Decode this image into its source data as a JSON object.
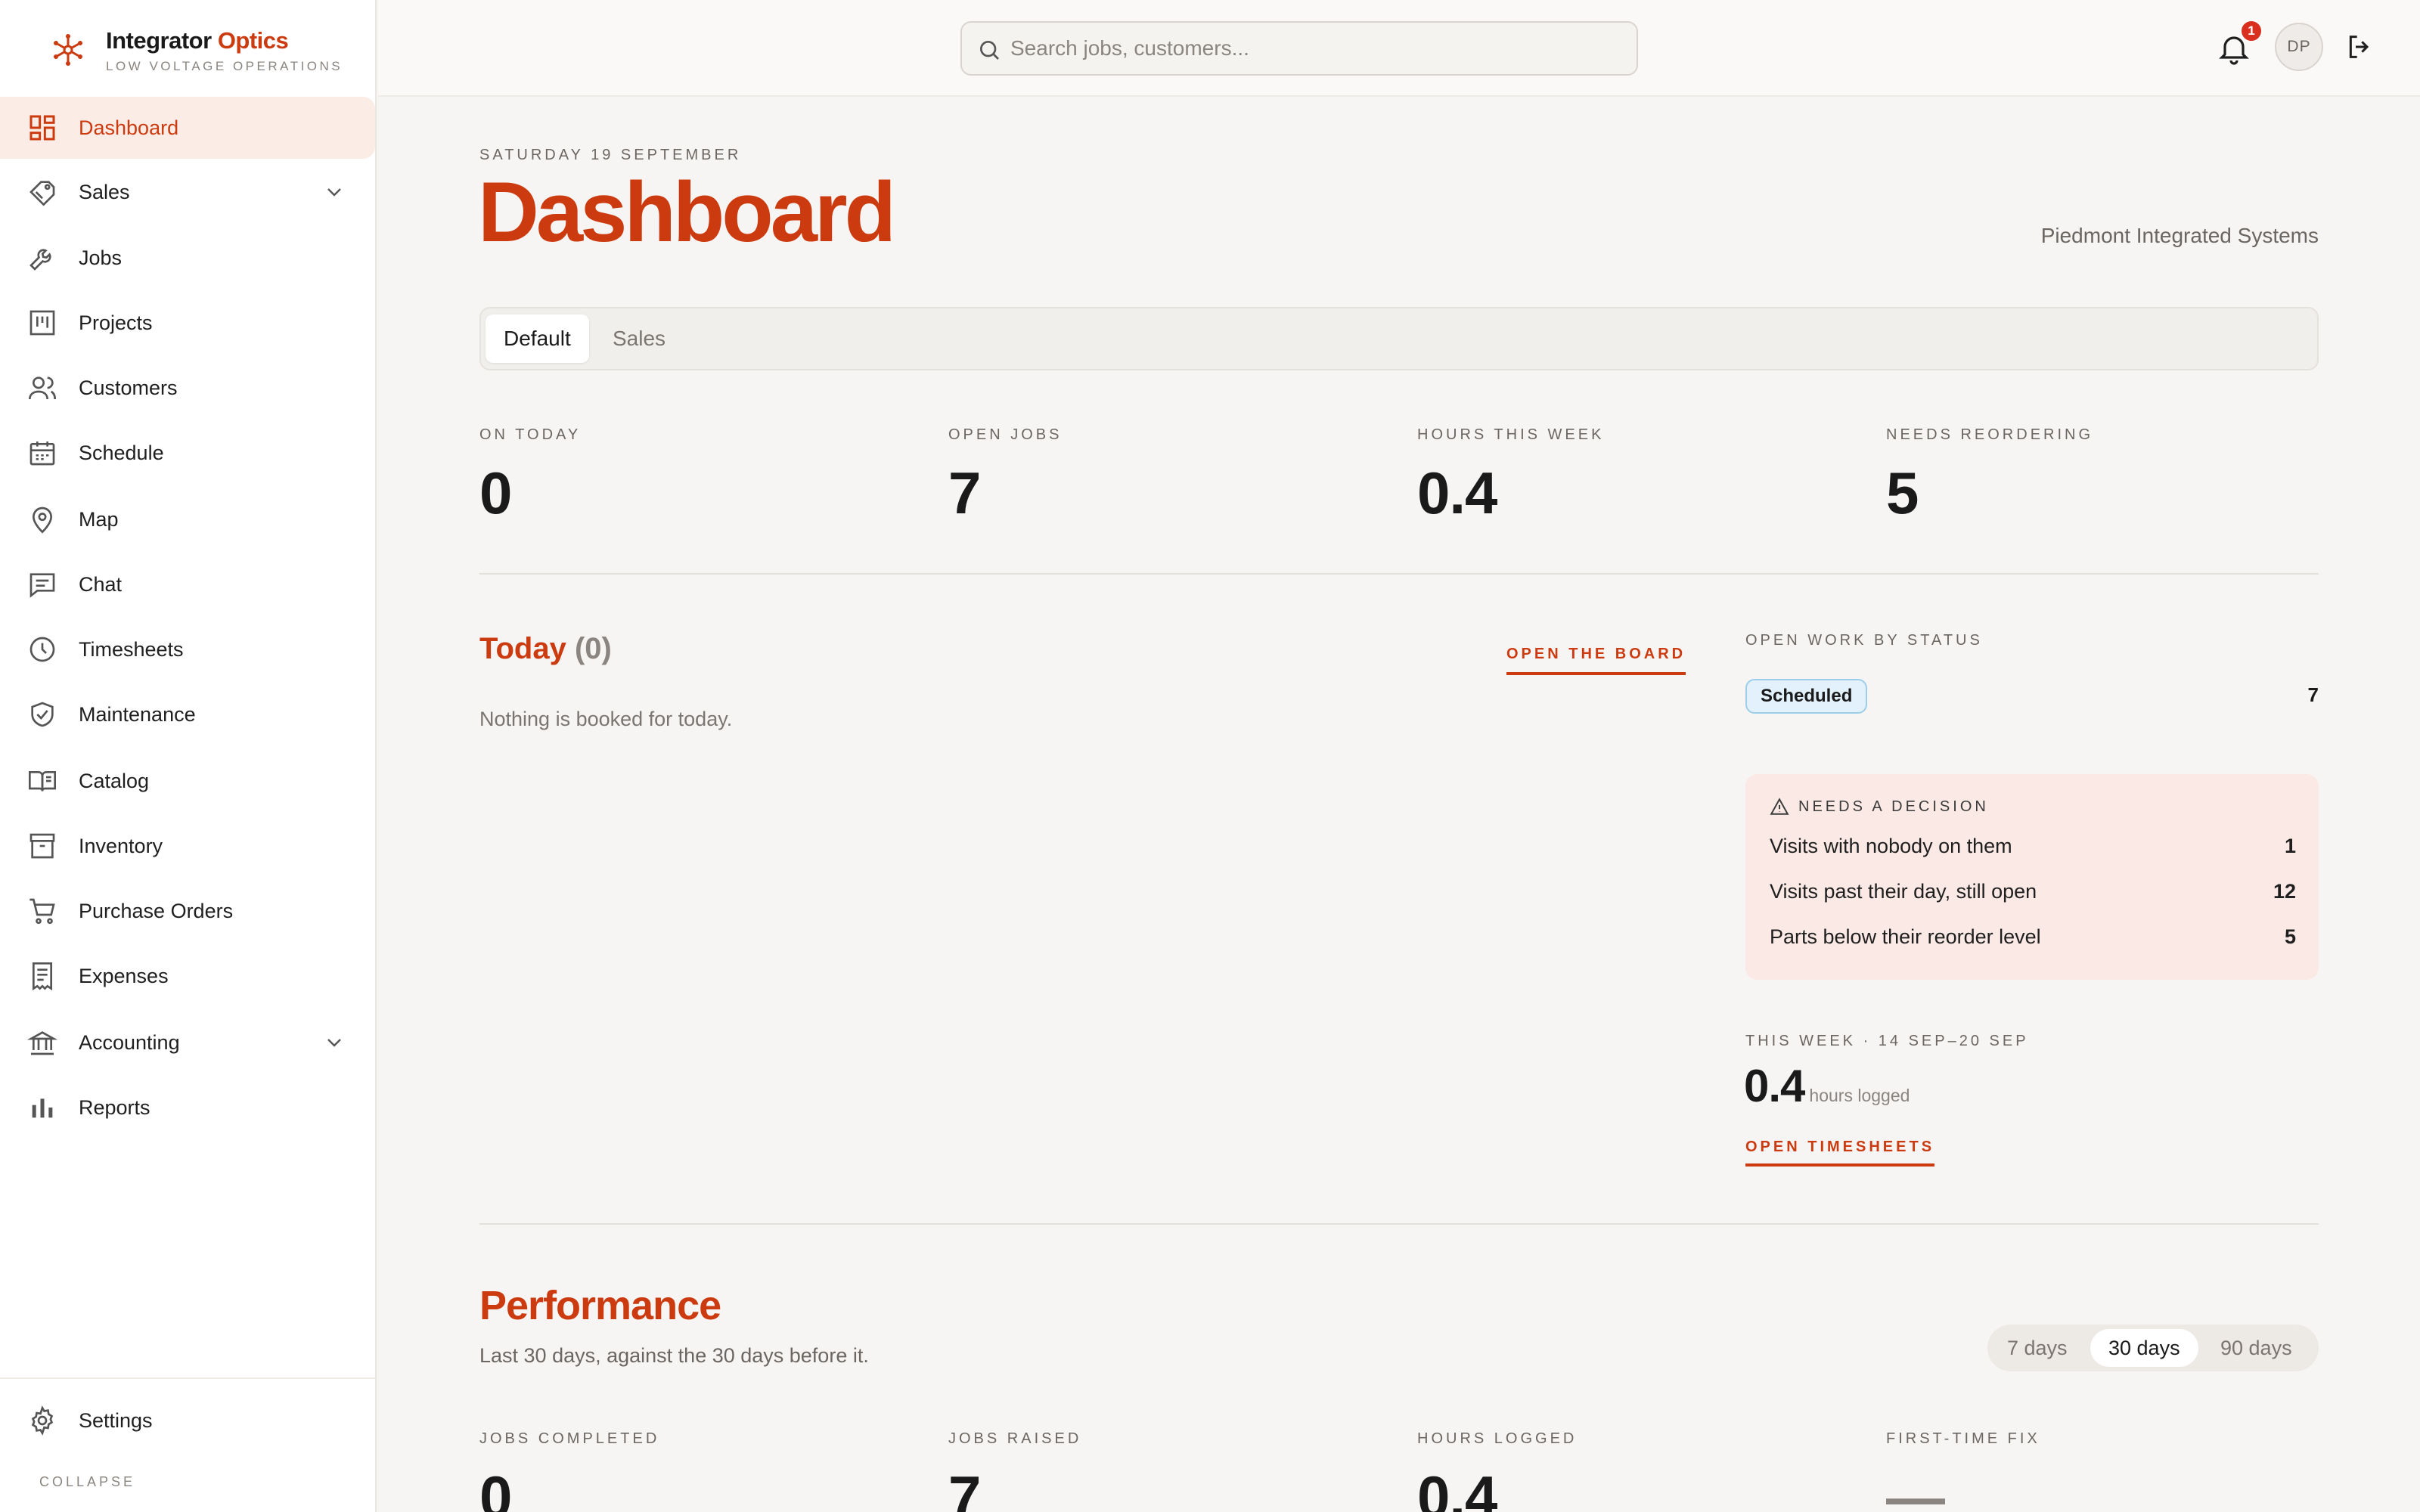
{
  "brand": {
    "name_main": "Integrator",
    "name_accent": "Optics",
    "tagline": "LOW VOLTAGE OPERATIONS",
    "accent_color": "#cc3a0f"
  },
  "sidebar": {
    "items": [
      {
        "label": "Dashboard",
        "icon": "dashboard-icon",
        "active": true
      },
      {
        "label": "Sales",
        "icon": "tag-icon",
        "expandable": true
      },
      {
        "label": "Jobs",
        "icon": "wrench-icon"
      },
      {
        "label": "Projects",
        "icon": "kanban-icon"
      },
      {
        "label": "Customers",
        "icon": "users-icon"
      },
      {
        "label": "Schedule",
        "icon": "calendar-icon"
      },
      {
        "label": "Map",
        "icon": "map-pin-icon"
      },
      {
        "label": "Chat",
        "icon": "chat-icon"
      },
      {
        "label": "Timesheets",
        "icon": "clock-icon"
      },
      {
        "label": "Maintenance",
        "icon": "shield-check-icon"
      },
      {
        "label": "Catalog",
        "icon": "book-icon"
      },
      {
        "label": "Inventory",
        "icon": "archive-icon"
      },
      {
        "label": "Purchase Orders",
        "icon": "cart-icon"
      },
      {
        "label": "Expenses",
        "icon": "receipt-icon"
      },
      {
        "label": "Accounting",
        "icon": "bank-icon",
        "expandable": true
      },
      {
        "label": "Reports",
        "icon": "bar-chart-icon"
      }
    ],
    "settings_label": "Settings",
    "collapse_label": "COLLAPSE"
  },
  "topbar": {
    "search_placeholder": "Search jobs, customers...",
    "notification_count": "1",
    "avatar_initials": "DP"
  },
  "page": {
    "date": "SATURDAY 19 SEPTEMBER",
    "title": "Dashboard",
    "company": "Piedmont Integrated Systems",
    "tabs": [
      {
        "label": "Default",
        "active": true
      },
      {
        "label": "Sales",
        "active": false
      }
    ]
  },
  "stats": [
    {
      "label": "ON TODAY",
      "value": "0"
    },
    {
      "label": "OPEN JOBS",
      "value": "7"
    },
    {
      "label": "HOURS THIS WEEK",
      "value": "0.4"
    },
    {
      "label": "NEEDS REORDERING",
      "value": "5"
    }
  ],
  "today": {
    "title": "Today",
    "count": "(0)",
    "board_link": "OPEN THE BOARD",
    "empty_message": "Nothing is booked for today."
  },
  "open_work": {
    "label": "OPEN WORK BY STATUS",
    "status": "Scheduled",
    "count": "7"
  },
  "decision": {
    "label": "NEEDS A DECISION",
    "rows": [
      {
        "label": "Visits with nobody on them",
        "value": "1"
      },
      {
        "label": "Visits past their day, still open",
        "value": "12"
      },
      {
        "label": "Parts below their reorder level",
        "value": "5"
      }
    ]
  },
  "week": {
    "label": "THIS WEEK · 14 SEP–20 SEP",
    "value": "0.4",
    "unit": "hours logged",
    "link": "OPEN TIMESHEETS"
  },
  "performance": {
    "title": "Performance",
    "subtitle": "Last 30 days, against the 30 days before it.",
    "ranges": [
      {
        "label": "7 days",
        "active": false
      },
      {
        "label": "30 days",
        "active": true
      },
      {
        "label": "90 days",
        "active": false
      }
    ],
    "stats": [
      {
        "label": "JOBS COMPLETED",
        "value": "0"
      },
      {
        "label": "JOBS RAISED",
        "value": "7"
      },
      {
        "label": "HOURS LOGGED",
        "value": "0.4"
      },
      {
        "label": "FIRST-TIME FIX",
        "value": "—"
      }
    ]
  }
}
